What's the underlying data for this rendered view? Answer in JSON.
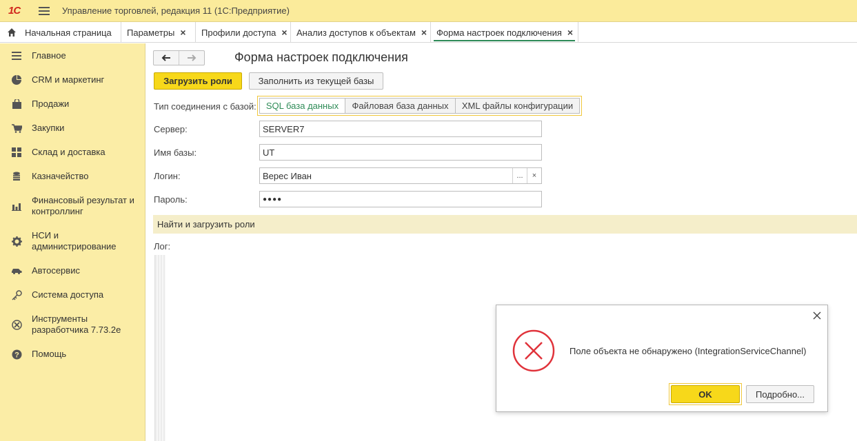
{
  "app": {
    "logo_text": "1С",
    "title": "Управление торговлей, редакция 11  (1С:Предприятие)"
  },
  "tabs": [
    {
      "label": "Начальная страница",
      "closable": false
    },
    {
      "label": "Параметры",
      "closable": true
    },
    {
      "label": "Профили доступа",
      "closable": true
    },
    {
      "label": "Анализ доступов к объектам",
      "closable": true
    },
    {
      "label": "Форма настроек подключения",
      "closable": true,
      "active": true
    }
  ],
  "sidebar": {
    "items": [
      {
        "label": "Главное",
        "icon": "list-icon"
      },
      {
        "label": "CRM и маркетинг",
        "icon": "pie-chart-icon"
      },
      {
        "label": "Продажи",
        "icon": "bag-icon"
      },
      {
        "label": "Закупки",
        "icon": "cart-icon"
      },
      {
        "label": "Склад и доставка",
        "icon": "grid-icon"
      },
      {
        "label": "Казначейство",
        "icon": "coins-icon"
      },
      {
        "label": "Финансовый результат и контроллинг",
        "icon": "bar-chart-icon"
      },
      {
        "label": "НСИ и администрирование",
        "icon": "gear-icon"
      },
      {
        "label": "Автосервис",
        "icon": "car-icon"
      },
      {
        "label": "Система доступа",
        "icon": "key-icon"
      },
      {
        "label": "Инструменты разработчика 7.73.2e",
        "icon": "tools-icon"
      },
      {
        "label": "Помощь",
        "icon": "help-icon"
      }
    ]
  },
  "form": {
    "title": "Форма настроек подключения",
    "load_roles_button": "Загрузить роли",
    "fill_from_current_button": "Заполнить из текущей базы",
    "connection_type_label": "Тип соединения с базой:",
    "connection_types": [
      "SQL база данных",
      "Файловая база данных",
      "XML файлы конфигурации"
    ],
    "connection_type_selected": "SQL база данных",
    "server_label": "Сервер:",
    "server_value": "SERVER7",
    "dbname_label": "Имя базы:",
    "dbname_value": "UT",
    "login_label": "Логин:",
    "login_value": "Верес Иван",
    "login_select_button": "...",
    "login_clear_button": "×",
    "password_label": "Пароль:",
    "password_value": "●●●●",
    "section_title": "Найти и загрузить роли",
    "log_label": "Лог:"
  },
  "dialog": {
    "message": "Поле объекта не обнаружено (IntegrationServiceChannel)",
    "ok_button": "OK",
    "more_button": "Подробно...",
    "error_color": "#e0333b"
  },
  "colors": {
    "accent_yellow": "#f7d81a",
    "sidebar_bg": "#fbeda6",
    "active_green": "#2e8b57"
  }
}
